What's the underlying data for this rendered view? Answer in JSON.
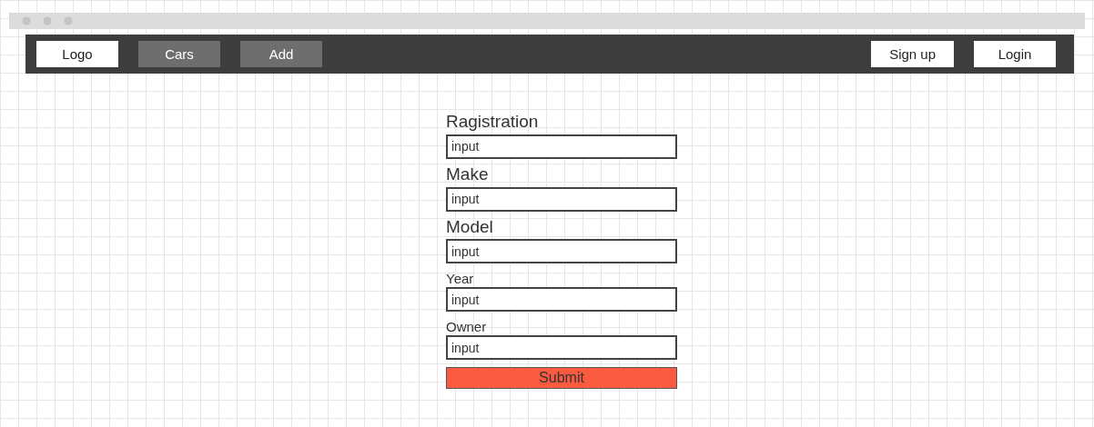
{
  "navbar": {
    "left": [
      {
        "label": "Logo",
        "kind": "light"
      },
      {
        "label": "Cars",
        "kind": "dark"
      },
      {
        "label": "Add",
        "kind": "dark"
      }
    ],
    "right": [
      {
        "label": "Sign up",
        "kind": "light"
      },
      {
        "label": "Login",
        "kind": "light"
      }
    ]
  },
  "form": {
    "fields": [
      {
        "label": "Ragistration",
        "kind": "large",
        "value": "input"
      },
      {
        "label": "Make",
        "kind": "large",
        "value": "input"
      },
      {
        "label": "Model",
        "kind": "large",
        "value": "input"
      },
      {
        "label": "Year",
        "kind": "small",
        "value": "input"
      },
      {
        "label": "Owner",
        "kind": "small",
        "value": "input"
      }
    ],
    "submit": "Submit"
  }
}
